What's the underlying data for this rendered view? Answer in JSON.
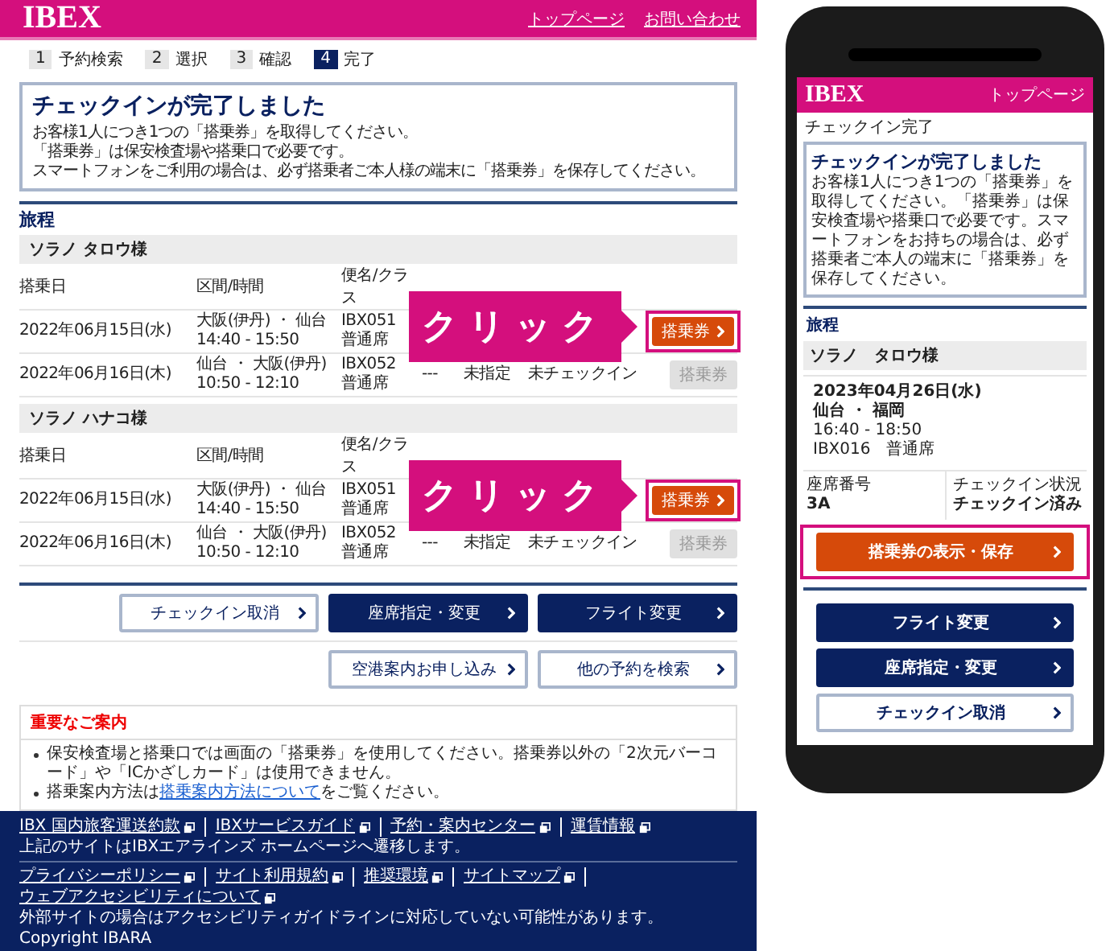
{
  "desktop": {
    "header": {
      "logo": "IBEX",
      "links": [
        "トップページ",
        "お問い合わせ"
      ]
    },
    "steps": [
      {
        "number": "1",
        "label": "予約検索",
        "selected": false
      },
      {
        "number": "2",
        "label": "選択",
        "selected": false
      },
      {
        "number": "3",
        "label": "確認",
        "selected": false
      },
      {
        "number": "4",
        "label": "完了",
        "selected": true
      }
    ],
    "complete_box": {
      "title": "チェックインが完了しました",
      "lines": [
        "お客様1人につき1つの「搭乗券」を取得してください。",
        "「搭乗券」は保安検査場や搭乗口で必要です。",
        "スマートフォンをご利用の場合は、必ず搭乗者ご本人様の端末に「搭乗券」を保存してください。"
      ]
    },
    "itinerary": {
      "title": "旅程",
      "passengers": [
        {
          "name": "ソラノ タロウ様",
          "columns": [
            "搭乗日",
            "区間/時間",
            "便名/クラス"
          ],
          "callout": "クリック",
          "rows": [
            {
              "date": "2022年06月15日(水)",
              "route": "大阪(伊丹) ・ 仙台",
              "time": "14:40 - 15:50",
              "flight": "IBX051",
              "class": "普通席",
              "button": {
                "label": "搭乗券",
                "disabled": false,
                "highlighted": true
              }
            },
            {
              "date": "2022年06月16日(木)",
              "route": "仙台 ・ 大阪(伊丹)",
              "time": "10:50 - 12:10",
              "flight": "IBX052",
              "class": "普通席",
              "seat": "---",
              "seat_request": "未指定",
              "checkin_status": "未チェックイン",
              "button": {
                "label": "搭乗券",
                "disabled": true,
                "highlighted": false
              }
            }
          ]
        },
        {
          "name": "ソラノ ハナコ様",
          "columns": [
            "搭乗日",
            "区間/時間",
            "便名/クラス"
          ],
          "callout": "クリック",
          "rows": [
            {
              "date": "2022年06月15日(水)",
              "route": "大阪(伊丹) ・ 仙台",
              "time": "14:40 - 15:50",
              "flight": "IBX051",
              "class": "普通席",
              "button": {
                "label": "搭乗券",
                "disabled": false,
                "highlighted": true
              }
            },
            {
              "date": "2022年06月16日(木)",
              "route": "仙台 ・ 大阪(伊丹)",
              "time": "10:50 - 12:10",
              "flight": "IBX052",
              "class": "普通席",
              "seat": "---",
              "seat_request": "未指定",
              "checkin_status": "未チェックイン",
              "button": {
                "label": "搭乗券",
                "disabled": true,
                "highlighted": false
              }
            }
          ]
        }
      ]
    },
    "actions": [
      {
        "label": "チェックイン取消",
        "kind": "outline"
      },
      {
        "label": "座席指定・変更",
        "kind": "filled"
      },
      {
        "label": "フライト変更",
        "kind": "filled"
      }
    ],
    "actions_2": [
      {
        "label": "空港案内お申し込み",
        "kind": "outline"
      },
      {
        "label": "他の予約を検索",
        "kind": "outline"
      }
    ],
    "notice": {
      "title": "重要なご案内",
      "items": [
        {
          "text": "保安検査場と搭乗口では画面の「搭乗券」を使用してください。搭乗券以外の「2次元バーコード」や「ICかざしカード」は使用できません。"
        },
        {
          "text": "搭乗案内方法は",
          "link": "搭乗案内方法について",
          "after": "をご覧ください。"
        }
      ]
    },
    "footer": {
      "links": [
        "IBX 国内旅客運送約款",
        "IBXサービスガイド",
        "予約・案内センター",
        "運賃情報"
      ],
      "note": "上記のサイトはIBXエアラインズ ホームページへ遷移します。",
      "links_2": [
        "プライバシーポリシー",
        "サイト利用規約",
        "推奨環境",
        "サイトマップ",
        "ウェブアクセシビリティについて"
      ],
      "note_2": "外部サイトの場合はアクセシビリティガイドラインに対応していない可能性があります。",
      "copyright": "Copyright IBARA"
    }
  },
  "phone": {
    "header": {
      "logo": "IBEX",
      "link": "トップページ"
    },
    "breadcrumb": "チェックイン完了",
    "complete_box": {
      "title": "チェックインが完了しました",
      "text": "お客様1人につき1つの「搭乗券」を取得してください。「搭乗券」は保安検査場や搭乗口で必要です。スマートフォンをお持ちの場合は、必ず搭乗者ご本人の端末に「搭乗券」を保存してください。"
    },
    "itinerary_title": "旅程",
    "passenger": "ソラノ　タロウ様",
    "date": "2023年04月26日(水)",
    "route": "仙台 ・ 福岡",
    "time": "16:40 - 18:50",
    "flight": "IBX016　普通席",
    "seat_label": "座席番号",
    "seat": "3A",
    "status_label": "チェックイン状況",
    "status": "チェックイン済み",
    "primary_button": {
      "label": "搭乗券の表示・保存",
      "highlighted": true
    },
    "buttons": [
      {
        "label": "フライト変更",
        "kind": "filled"
      },
      {
        "label": "座席指定・変更",
        "kind": "filled"
      },
      {
        "label": "チェックイン取消",
        "kind": "outline"
      }
    ]
  }
}
